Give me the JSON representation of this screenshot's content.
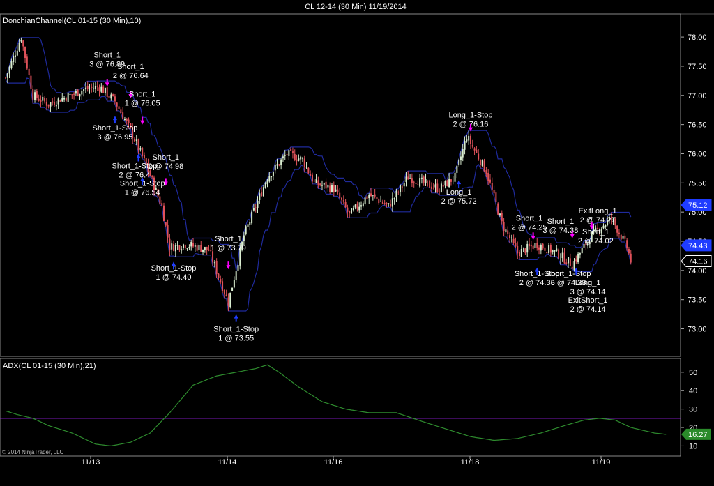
{
  "window_title": "CL 12-14 (30 Min)  11/19/2014",
  "copyright": "© 2014 NinjaTrader, LLC",
  "colors": {
    "background": "#000000",
    "channel": "#1f2a9c",
    "up_candle": "#d9ecd0",
    "down_candle": "#e0525a",
    "adx_line": "#2e8b2e",
    "level_line": "#a020f0",
    "short_arrow": "#ff00ff",
    "stop_arrow": "#1f3cff",
    "price_last": "#ffffff",
    "price_upper": "#1f3cff",
    "adx_tag": "#2a8a2a"
  },
  "chart_data": [
    {
      "type": "candlestick",
      "title": "DonchianChannel(CL 01-15 (30 Min),10)",
      "ylim": [
        72.6,
        78.3
      ],
      "yticks": [
        "78.00",
        "77.50",
        "77.00",
        "76.50",
        "76.00",
        "75.50",
        "75.00",
        "74.50",
        "74.00",
        "73.50",
        "73.00"
      ],
      "price_tags": [
        {
          "label": "75.12",
          "value": 75.12,
          "kind": "upper"
        },
        {
          "label": "74.43",
          "value": 74.43,
          "kind": "lower"
        },
        {
          "label": "74.16",
          "value": 74.16,
          "kind": "last"
        }
      ],
      "xlabels": [
        "11/13",
        "11/14",
        "11/16",
        "11/18",
        "11/19"
      ],
      "anchors": [
        {
          "i": 0,
          "v": 77.3
        },
        {
          "i": 8,
          "v": 78.0
        },
        {
          "i": 14,
          "v": 77.0
        },
        {
          "i": 22,
          "v": 76.85
        },
        {
          "i": 40,
          "v": 77.1
        },
        {
          "i": 48,
          "v": 77.15
        },
        {
          "i": 56,
          "v": 76.9
        },
        {
          "i": 64,
          "v": 76.4
        },
        {
          "i": 72,
          "v": 75.8
        },
        {
          "i": 80,
          "v": 75.1
        },
        {
          "i": 84,
          "v": 74.4
        },
        {
          "i": 92,
          "v": 74.45
        },
        {
          "i": 104,
          "v": 74.35
        },
        {
          "i": 114,
          "v": 73.45
        },
        {
          "i": 122,
          "v": 74.6
        },
        {
          "i": 134,
          "v": 75.6
        },
        {
          "i": 144,
          "v": 76.0
        },
        {
          "i": 152,
          "v": 75.9
        },
        {
          "i": 158,
          "v": 75.5
        },
        {
          "i": 168,
          "v": 75.4
        },
        {
          "i": 176,
          "v": 74.95
        },
        {
          "i": 186,
          "v": 75.3
        },
        {
          "i": 196,
          "v": 75.1
        },
        {
          "i": 206,
          "v": 75.6
        },
        {
          "i": 214,
          "v": 75.5
        },
        {
          "i": 222,
          "v": 75.4
        },
        {
          "i": 230,
          "v": 75.6
        },
        {
          "i": 236,
          "v": 76.3
        },
        {
          "i": 246,
          "v": 75.7
        },
        {
          "i": 254,
          "v": 74.8
        },
        {
          "i": 262,
          "v": 74.3
        },
        {
          "i": 272,
          "v": 74.45
        },
        {
          "i": 282,
          "v": 74.3
        },
        {
          "i": 290,
          "v": 74.1
        },
        {
          "i": 300,
          "v": 74.6
        },
        {
          "i": 310,
          "v": 74.9
        },
        {
          "i": 318,
          "v": 74.4
        },
        {
          "i": 320,
          "v": 74.16
        }
      ],
      "annotations": [
        {
          "text": [
            "Short_1",
            "3 @ 76.89"
          ],
          "i": 52,
          "v": 77.65,
          "arrow": "short",
          "ai": 52,
          "av": 77.15
        },
        {
          "text": [
            "Short_1",
            "2 @ 76.64"
          ],
          "i": 64,
          "v": 77.45,
          "arrow": "short",
          "ai": 64,
          "av": 76.95
        },
        {
          "text": [
            "Short_1",
            "1 @ 76.05"
          ],
          "i": 70,
          "v": 76.98,
          "arrow": "short",
          "ai": 70,
          "av": 76.5
        },
        {
          "text": [
            "Short_1-Stop",
            "3 @ 76.95"
          ],
          "i": 56,
          "v": 76.4,
          "arrow": "stop",
          "ai": 56,
          "av": 76.65
        },
        {
          "text": [
            "Short_1",
            "2 @ 74.98"
          ],
          "i": 82,
          "v": 75.9,
          "arrow": "short",
          "ai": 82,
          "av": 75.45
        },
        {
          "text": [
            "Short_1-Stop",
            "2 @ 76.4"
          ],
          "i": 66,
          "v": 75.75,
          "arrow": "stop",
          "ai": 68,
          "av": 76.0
        },
        {
          "text": [
            "Short_1-Stop",
            "1 @ 76.54"
          ],
          "i": 70,
          "v": 75.45,
          "arrow": "stop",
          "ai": 70,
          "av": 75.6
        },
        {
          "text": [
            "Short_1-Stop",
            "1 @ 74.40"
          ],
          "i": 86,
          "v": 74.0,
          "arrow": "stop",
          "ai": 86,
          "av": 74.15
        },
        {
          "text": [
            "Short_1",
            "1 @ 73.79"
          ],
          "i": 114,
          "v": 74.5,
          "arrow": "short",
          "ai": 114,
          "av": 74.02
        },
        {
          "text": [
            "Short_1-Stop",
            "1 @ 73.55"
          ],
          "i": 118,
          "v": 72.95,
          "arrow": "stop",
          "ai": 118,
          "av": 73.25
        },
        {
          "text": [
            "Long_1-Stop",
            "2 @ 76.16"
          ],
          "i": 238,
          "v": 76.62,
          "arrow": "short",
          "ai": 238,
          "av": 76.38
        },
        {
          "text": [
            "Long_1",
            "2 @ 75.72"
          ],
          "i": 232,
          "v": 75.3,
          "arrow": "stop",
          "ai": 232,
          "av": 75.55
        },
        {
          "text": [
            "Short_1",
            "2 @ 74.25"
          ],
          "i": 268,
          "v": 74.85,
          "arrow": "short",
          "ai": 270,
          "av": 74.52
        },
        {
          "text": [
            "Short_1-Stop",
            "2 @ 74.36"
          ],
          "i": 272,
          "v": 73.9,
          "arrow": "stop",
          "ai": 272,
          "av": 74.05
        },
        {
          "text": [
            "Short_1",
            "3 @ 74.38"
          ],
          "i": 284,
          "v": 74.8,
          "arrow": "short",
          "ai": 290,
          "av": 74.55
        },
        {
          "text": [
            "ExitLong_1",
            "2 @ 74.27"
          ],
          "i": 303,
          "v": 74.98,
          "arrow": "short",
          "ai": 300,
          "av": 74.7
        },
        {
          "text": [
            "Short_1",
            "2 @ 74.02"
          ],
          "i": 302,
          "v": 74.62,
          "arrow": "none",
          "ai": 0,
          "av": 0
        },
        {
          "text": [
            "Short_1-Stop",
            "3 @ 74.33"
          ],
          "i": 288,
          "v": 73.9,
          "arrow": "stop",
          "ai": 292,
          "av": 74.05
        },
        {
          "text": [
            "Long_1",
            "3 @ 74.14"
          ],
          "i": 298,
          "v": 73.75,
          "arrow": "none",
          "ai": 0,
          "av": 0
        },
        {
          "text": [
            "ExitShort_1",
            "2 @ 74.14"
          ],
          "i": 298,
          "v": 73.45,
          "arrow": "none",
          "ai": 0,
          "av": 0
        }
      ]
    },
    {
      "type": "line",
      "title": "ADX(CL 01-15 (30 Min),21)",
      "ylim": [
        6,
        56
      ],
      "yticks": [
        "50",
        "40",
        "30",
        "20",
        "10"
      ],
      "level": 25,
      "last_tag": {
        "label": "16.27",
        "value": 16.27
      },
      "values": [
        {
          "i": 0,
          "v": 29
        },
        {
          "i": 6,
          "v": 27
        },
        {
          "i": 14,
          "v": 25
        },
        {
          "i": 22,
          "v": 21
        },
        {
          "i": 34,
          "v": 17
        },
        {
          "i": 46,
          "v": 11
        },
        {
          "i": 54,
          "v": 10
        },
        {
          "i": 64,
          "v": 12
        },
        {
          "i": 74,
          "v": 17
        },
        {
          "i": 84,
          "v": 28
        },
        {
          "i": 96,
          "v": 43
        },
        {
          "i": 108,
          "v": 48
        },
        {
          "i": 118,
          "v": 50
        },
        {
          "i": 128,
          "v": 52
        },
        {
          "i": 134,
          "v": 54
        },
        {
          "i": 140,
          "v": 50
        },
        {
          "i": 150,
          "v": 42
        },
        {
          "i": 162,
          "v": 34
        },
        {
          "i": 174,
          "v": 30
        },
        {
          "i": 186,
          "v": 28
        },
        {
          "i": 200,
          "v": 28
        },
        {
          "i": 214,
          "v": 23
        },
        {
          "i": 226,
          "v": 19
        },
        {
          "i": 238,
          "v": 15
        },
        {
          "i": 250,
          "v": 13
        },
        {
          "i": 262,
          "v": 14
        },
        {
          "i": 274,
          "v": 17
        },
        {
          "i": 286,
          "v": 21
        },
        {
          "i": 296,
          "v": 24
        },
        {
          "i": 304,
          "v": 25
        },
        {
          "i": 312,
          "v": 24
        },
        {
          "i": 320,
          "v": 20
        },
        {
          "i": 332,
          "v": 17
        },
        {
          "i": 338,
          "v": 16.27
        }
      ]
    }
  ]
}
